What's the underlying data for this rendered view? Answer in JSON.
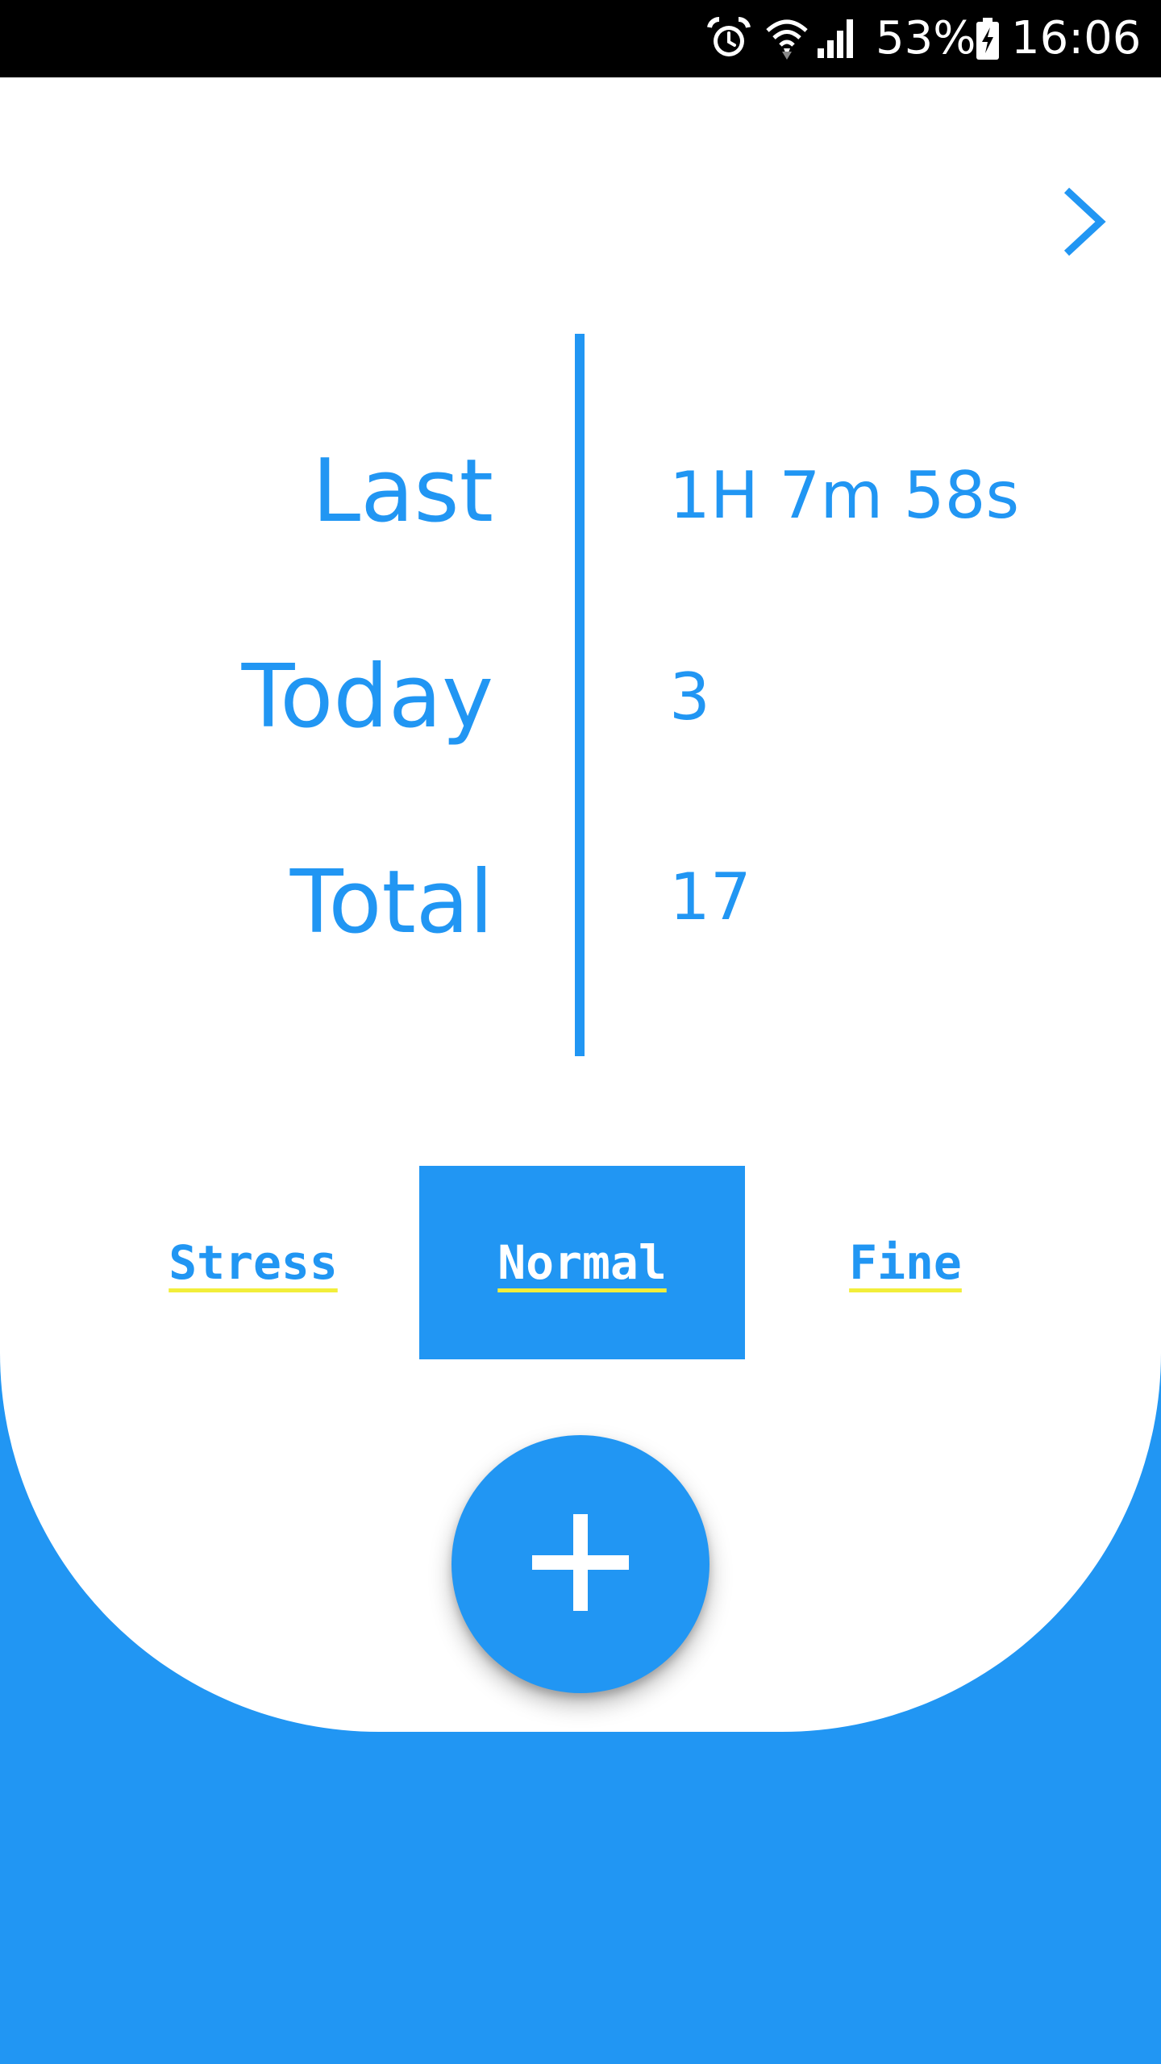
{
  "status_bar": {
    "battery": "53%",
    "time": "16:06",
    "icons": [
      "alarm-icon",
      "wifi-icon",
      "signal-icon",
      "battery-charging-icon"
    ]
  },
  "header": {
    "next_icon": "chevron-right-icon"
  },
  "stats": {
    "last_label": "Last",
    "last_value": "1H 7m 58s",
    "today_label": "Today",
    "today_value": "3",
    "total_label": "Total",
    "total_value": "17"
  },
  "mood": {
    "options": [
      "Stress",
      "Normal",
      "Fine"
    ],
    "selected": "Normal"
  },
  "fab": {
    "icon": "plus-icon"
  },
  "colors": {
    "accent": "#2196F3",
    "background": "#FFFFFF",
    "underline": "#F2EE3A",
    "status_bar": "#000000"
  }
}
